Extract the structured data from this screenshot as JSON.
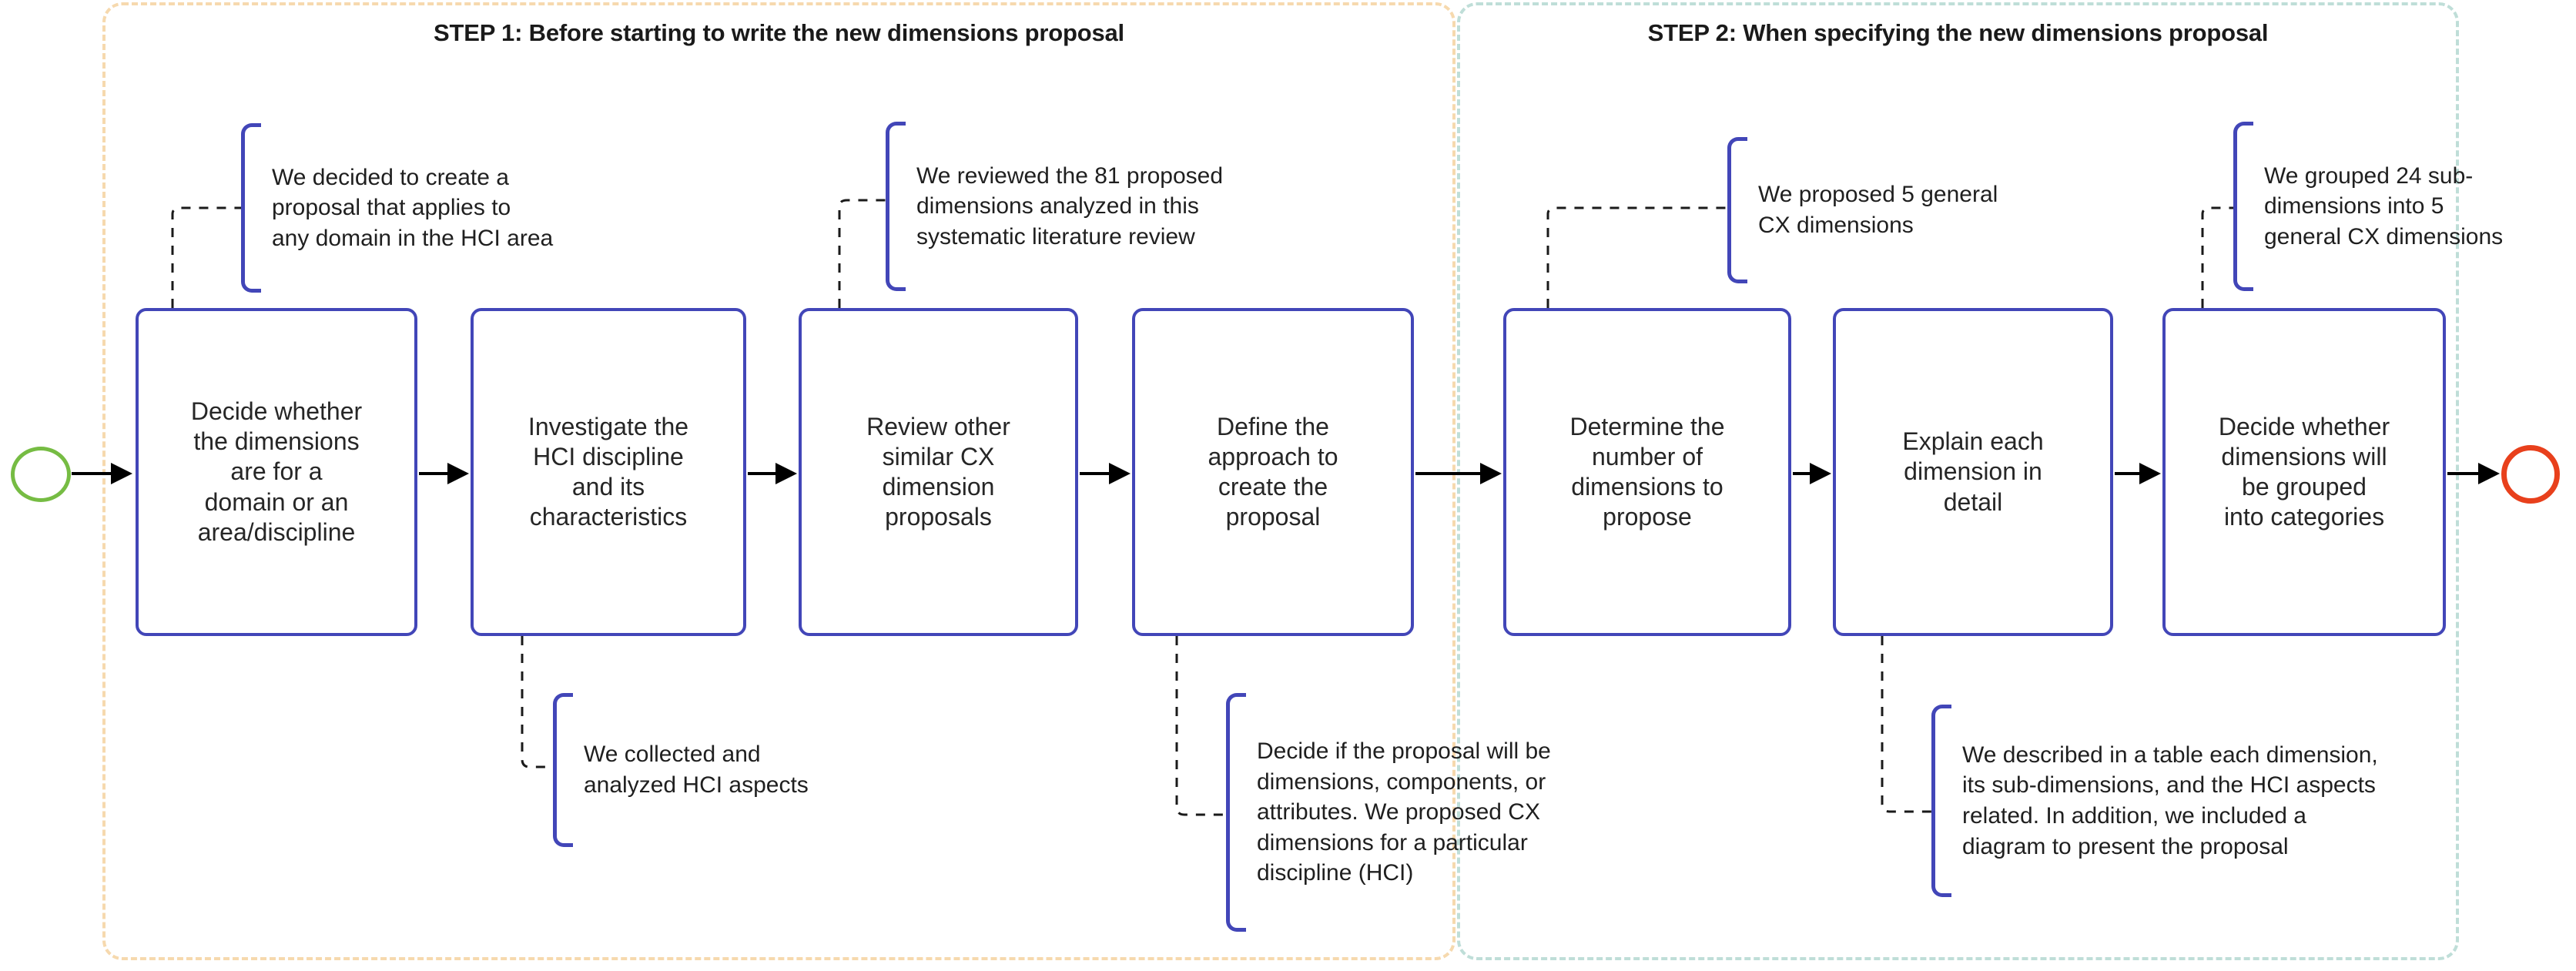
{
  "diagram": {
    "title_step1": "STEP 1: Before starting to write the new dimensions proposal",
    "title_step2": "STEP 2: When specifying the new dimensions proposal",
    "colors": {
      "step1_border": "#f6d9ae",
      "step2_border": "#bfded8",
      "process_box_border": "#4246b8",
      "callout_bracket": "#4246b8",
      "start_terminator": "#76bc43",
      "end_terminator": "#e8401c",
      "arrow": "#000000",
      "leader_line": "#1a1a1a",
      "text": "#262626"
    }
  },
  "terminators": {
    "start": "start-circle",
    "end": "end-circle"
  },
  "steps": [
    {
      "id": "step-1",
      "title": "STEP 1: Before starting to write the new dimensions proposal",
      "boxes": [
        {
          "id": "box-decide-domain",
          "label": "Decide whether\nthe dimensions\nare for a\ndomain or an\narea/discipline"
        },
        {
          "id": "box-investigate-hci",
          "label": "Investigate the\nHCI discipline\nand its\ncharacteristics"
        },
        {
          "id": "box-review-cx",
          "label": "Review other\nsimilar CX\ndimension\nproposals"
        },
        {
          "id": "box-define-approach",
          "label": "Define the\napproach to\ncreate the\nproposal"
        }
      ]
    },
    {
      "id": "step-2",
      "title": "STEP 2: When specifying the new dimensions proposal",
      "boxes": [
        {
          "id": "box-determine-number",
          "label": "Determine the\nnumber of\ndimensions to\npropose"
        },
        {
          "id": "box-explain-each",
          "label": "Explain each\ndimension in\ndetail"
        },
        {
          "id": "box-group-categories",
          "label": "Decide whether\ndimensions will\nbe grouped\ninto categories"
        }
      ]
    }
  ],
  "callouts": [
    {
      "id": "callout-any-domain",
      "position": "top",
      "attached_to": "box-decide-domain",
      "text": "We decided to create a\nproposal that applies to\nany domain in the HCI area"
    },
    {
      "id": "callout-81-dimensions",
      "position": "top",
      "attached_to": "box-review-cx",
      "text": "We reviewed the 81 proposed\ndimensions analyzed in this\nsystematic literature review"
    },
    {
      "id": "callout-5-general-cx",
      "position": "top",
      "attached_to": "box-determine-number",
      "text": "We proposed 5 general\nCX dimensions"
    },
    {
      "id": "callout-24-subdimensions",
      "position": "top",
      "attached_to": "box-group-categories",
      "text": "We grouped 24 sub-\ndimensions into 5\ngeneral CX dimensions"
    },
    {
      "id": "callout-hci-aspects",
      "position": "bottom",
      "attached_to": "box-investigate-hci",
      "text": "We collected and\nanalyzed HCI aspects"
    },
    {
      "id": "callout-dimensions-components",
      "position": "bottom",
      "attached_to": "box-define-approach",
      "text": "Decide if the proposal will be\ndimensions, components, or\nattributes. We proposed CX\ndimensions for a particular\ndiscipline (HCI)"
    },
    {
      "id": "callout-table-description",
      "position": "bottom",
      "attached_to": "box-explain-each",
      "text": "We described in a table each dimension,\nits sub-dimensions, and the HCI aspects\nrelated. In addition, we included a\ndiagram to present the proposal"
    }
  ]
}
